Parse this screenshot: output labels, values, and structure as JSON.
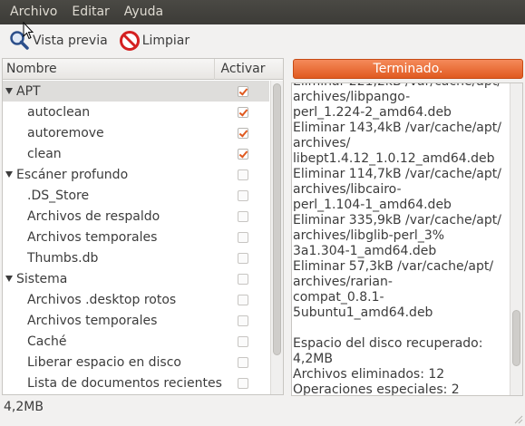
{
  "menubar": {
    "items": [
      "Archivo",
      "Editar",
      "Ayuda"
    ]
  },
  "toolbar": {
    "preview_label": "Vista previa",
    "clear_label": "Limpiar"
  },
  "tree": {
    "col_name": "Nombre",
    "col_active": "Activar",
    "rows": [
      {
        "label": "APT",
        "type": "parent",
        "checked": true,
        "selected": true
      },
      {
        "label": "autoclean",
        "type": "child",
        "checked": true
      },
      {
        "label": "autoremove",
        "type": "child",
        "checked": true
      },
      {
        "label": "clean",
        "type": "child",
        "checked": true
      },
      {
        "label": "Escáner profundo",
        "type": "parent",
        "checked": false
      },
      {
        "label": ".DS_Store",
        "type": "child",
        "checked": false
      },
      {
        "label": "Archivos de respaldo",
        "type": "child",
        "checked": false
      },
      {
        "label": "Archivos temporales",
        "type": "child",
        "checked": false
      },
      {
        "label": "Thumbs.db",
        "type": "child",
        "checked": false
      },
      {
        "label": "Sistema",
        "type": "parent",
        "checked": false
      },
      {
        "label": "Archivos .desktop rotos",
        "type": "child",
        "checked": false
      },
      {
        "label": "Archivos temporales",
        "type": "child",
        "checked": false
      },
      {
        "label": "Caché",
        "type": "child",
        "checked": false
      },
      {
        "label": "Liberar espacio en disco",
        "type": "child",
        "checked": false
      },
      {
        "label": "Lista de documentos recientes",
        "type": "child",
        "checked": false
      }
    ]
  },
  "progress": {
    "label": "Terminado.",
    "fraction": 1.0
  },
  "log": {
    "text": "Eliminar 221,2kB /var/cache/apt/\narchives/libpango-\nperl_1.224-2_amd64.deb\nEliminar 143,4kB /var/cache/apt/\narchives/\nlibept1.4.12_1.0.12_amd64.deb\nEliminar 114,7kB /var/cache/apt/\narchives/libcairo-\nperl_1.104-1_amd64.deb\nEliminar 335,9kB /var/cache/apt/\narchives/libglib-perl_3%\n3a1.304-1_amd64.deb\nEliminar 57,3kB /var/cache/apt/\narchives/rarian-\ncompat_0.8.1-5ubuntu1_amd64.deb\n\nEspacio del disco recuperado:\n4,2MB\nArchivos eliminados: 12\nOperaciones especiales: 2"
  },
  "status": {
    "text": "4,2MB"
  },
  "colors": {
    "accent": "#e05a20",
    "menubar": "#3c3b37"
  }
}
